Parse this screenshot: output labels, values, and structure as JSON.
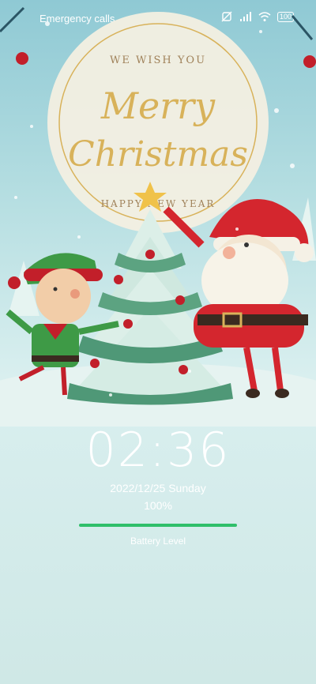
{
  "status_bar": {
    "left_text": "Emergency calls",
    "battery_text": "100",
    "icons": [
      "no-sim-icon",
      "signal-icon",
      "wifi-icon",
      "battery-icon"
    ]
  },
  "illustration": {
    "moon_text": {
      "top": "WE WISH YOU",
      "script_line1": "Merry",
      "script_line2": "Christmas",
      "bottom": "HAPPY NEW YEAR"
    }
  },
  "lock_screen": {
    "time": "02:36",
    "date": "2022/12/25 Sunday",
    "battery_percent": "100%",
    "battery_level_fraction": 1.0,
    "battery_label": "Battery Level"
  },
  "colors": {
    "progress": "#2fbf6a",
    "gold": "#d8b25a"
  }
}
